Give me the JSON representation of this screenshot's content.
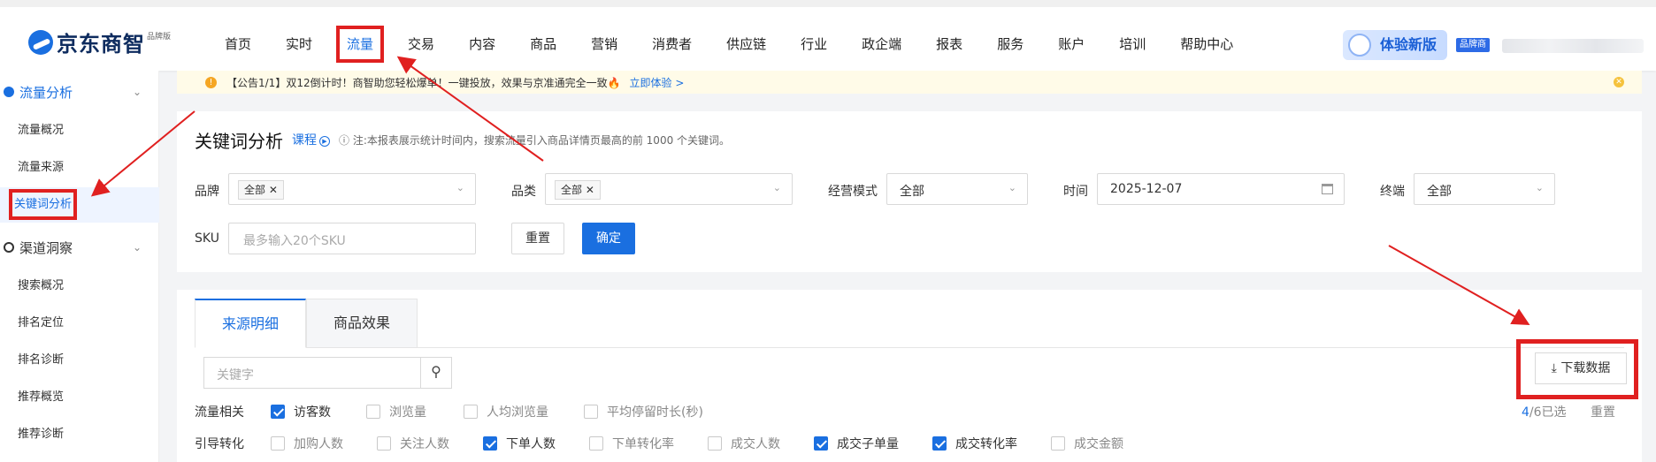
{
  "logo": {
    "name": "京东商智",
    "edition": "品牌版"
  },
  "nav": [
    {
      "label": "首页"
    },
    {
      "label": "实时"
    },
    {
      "label": "流量"
    },
    {
      "label": "交易"
    },
    {
      "label": "内容"
    },
    {
      "label": "商品"
    },
    {
      "label": "营销"
    },
    {
      "label": "消费者"
    },
    {
      "label": "供应链"
    },
    {
      "label": "行业"
    },
    {
      "label": "政企端"
    },
    {
      "label": "报表"
    },
    {
      "label": "服务"
    },
    {
      "label": "账户"
    },
    {
      "label": "培训"
    },
    {
      "label": "帮助中心"
    }
  ],
  "header": {
    "try_new": "体验新版",
    "brand_tag": "品牌商"
  },
  "sidebar": {
    "group1": {
      "label": "流量分析",
      "chevron": "chevron-down-icon"
    },
    "group1_items": [
      {
        "label": "流量概况"
      },
      {
        "label": "流量来源"
      },
      {
        "label": "关键词分析"
      }
    ],
    "group2": {
      "label": "渠道洞察",
      "chevron": "chevron-down-icon"
    },
    "group2_items": [
      {
        "label": "搜索概况"
      },
      {
        "label": "排名定位"
      },
      {
        "label": "排名诊断"
      },
      {
        "label": "推荐概览"
      },
      {
        "label": "推荐诊断"
      }
    ]
  },
  "notice": {
    "text": "【公告1/1】双12倒计时！商智助您轻松爆单！一键投放，效果与京准通完全一致🔥",
    "link": "立即体验 >"
  },
  "page": {
    "title": "关键词分析",
    "course": "课程",
    "note": "ⓘ 注:本报表展示统计时间内，搜索流量引入商品详情页最高的前 1000 个关键词。"
  },
  "filters": {
    "brand_label": "品牌",
    "brand_tag": "全部 ✕",
    "category_label": "品类",
    "category_tag": "全部 ✕",
    "mode_label": "经营模式",
    "mode_value": "全部",
    "time_label": "时间",
    "time_value": "2025-12-07",
    "terminal_label": "终端",
    "terminal_value": "全部",
    "sku_label": "SKU",
    "sku_placeholder": "最多输入20个SKU",
    "reset": "重置",
    "confirm": "确定"
  },
  "detail": {
    "tabs": [
      {
        "label": "来源明细"
      },
      {
        "label": "商品效果"
      }
    ],
    "search_placeholder": "关键字",
    "download": "下载数据",
    "row1_label": "流量相关",
    "row1": [
      {
        "label": "访客数",
        "checked": true
      },
      {
        "label": "浏览量",
        "checked": false
      },
      {
        "label": "人均浏览量",
        "checked": false
      },
      {
        "label": "平均停留时长(秒)",
        "checked": false
      }
    ],
    "row2_label": "引导转化",
    "row2": [
      {
        "label": "加购人数",
        "checked": false
      },
      {
        "label": "关注人数",
        "checked": false
      },
      {
        "label": "下单人数",
        "checked": true
      },
      {
        "label": "下单转化率",
        "checked": false
      },
      {
        "label": "成交人数",
        "checked": false
      },
      {
        "label": "成交子单量",
        "checked": true
      },
      {
        "label": "成交转化率",
        "checked": true
      },
      {
        "label": "成交金额",
        "checked": false
      }
    ],
    "selected_count": "4",
    "selected_total": "/6已选",
    "reset": "重置"
  },
  "colors": {
    "accent": "#1a6fe0",
    "annotation": "#e02020"
  }
}
